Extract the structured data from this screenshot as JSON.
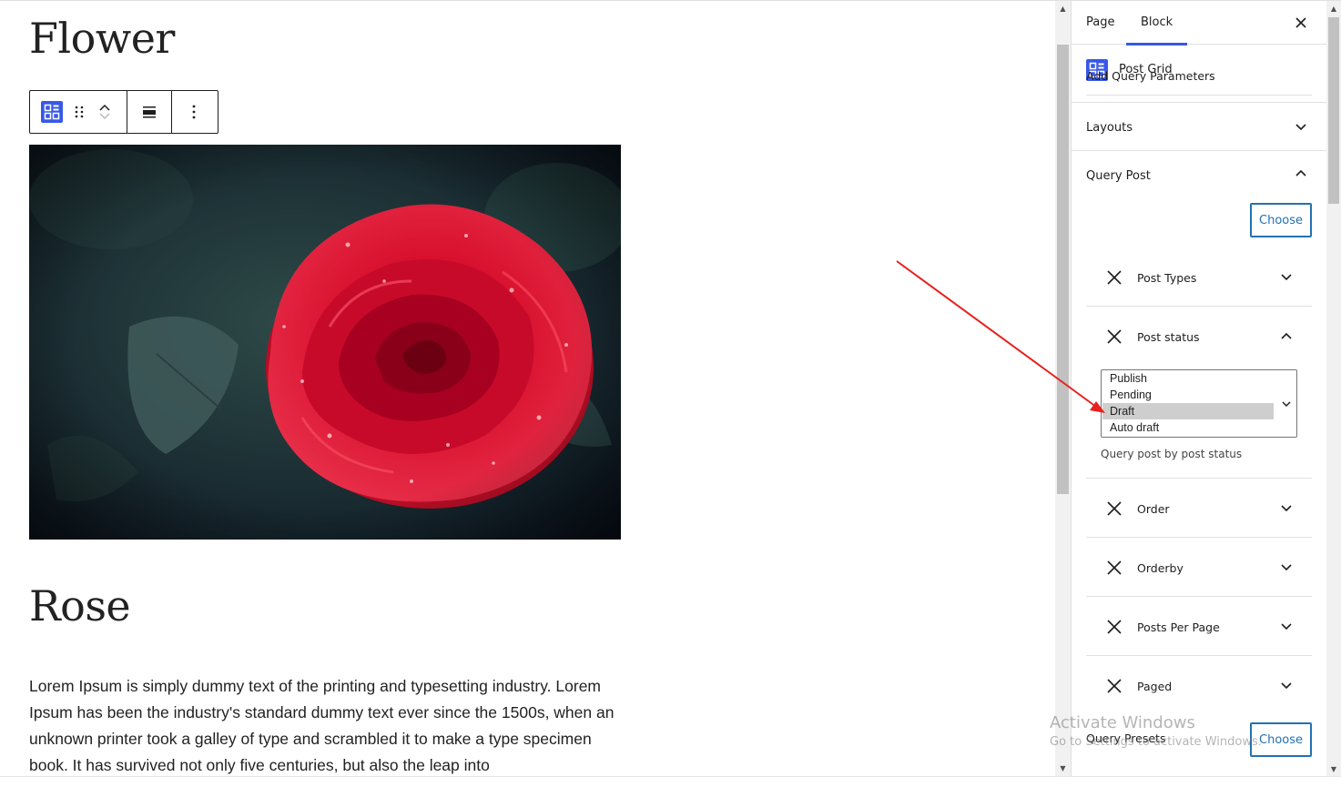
{
  "editor": {
    "post_title": "Flower",
    "second_post_title": "Rose",
    "excerpt": "Lorem Ipsum is simply dummy text of the printing and typesetting industry. Lorem Ipsum has been the industry's standard dummy text ever since the 1500s, when an unknown printer took a galley of type and scrambled it to make a type specimen book. It has survived not only five centuries, but also the leap into"
  },
  "sidebar": {
    "tabs": [
      {
        "label": "Page"
      },
      {
        "label": "Block",
        "active": true
      }
    ],
    "block_name": "Post Grid",
    "panels": {
      "layouts": "Layouts",
      "query_post": "Query Post"
    },
    "add_query_parameters": "Add Query Parameters",
    "choose_label": "Choose",
    "params": [
      {
        "label": "Post Types",
        "expanded": false
      },
      {
        "label": "Post status",
        "expanded": true
      },
      {
        "label": "Order",
        "expanded": false
      },
      {
        "label": "Orderby",
        "expanded": false
      },
      {
        "label": "Posts Per Page",
        "expanded": false
      },
      {
        "label": "Paged",
        "expanded": false
      }
    ],
    "post_status_options": [
      "Publish",
      "Pending",
      "Draft",
      "Auto draft"
    ],
    "post_status_selected": "Draft",
    "post_status_help": "Query post by post status",
    "query_presets": "Query Presets"
  },
  "watermark": {
    "line1": "Activate Windows",
    "line2": "Go to Settings to activate Windows."
  },
  "colors": {
    "accent": "#3858e9",
    "button_blue": "#2271b1",
    "annotation_red": "#e8201c"
  }
}
